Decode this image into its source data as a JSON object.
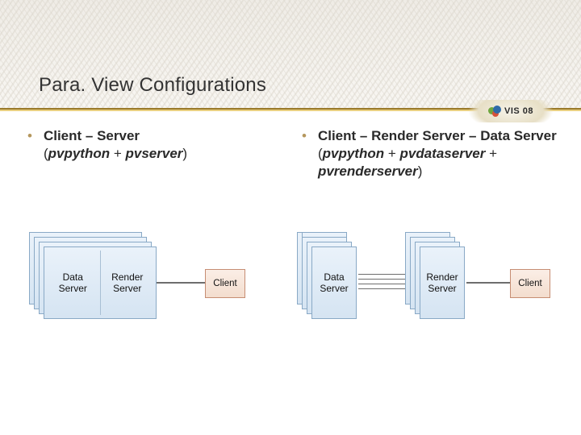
{
  "title": "Para. View Configurations",
  "logo": {
    "text": "VIS 08"
  },
  "left": {
    "heading": "Client – Server",
    "sub_open": "(",
    "sub_a": "pvpython",
    "sub_mid": " + ",
    "sub_b": "pvserver",
    "sub_close": ")",
    "card_data_server": "Data\nServer",
    "card_render_server": "Render\nServer",
    "client": "Client"
  },
  "right": {
    "heading": "Client – Render Server – Data Server",
    "sub_open": "(",
    "sub_a": "pvpython",
    "sub_mid1": " + ",
    "sub_b": "pvdataserver",
    "sub_mid2": " + ",
    "sub_c": "pvrenderserver",
    "sub_close": ")",
    "card_data_server": "Data\nServer",
    "card_render_server": "Render\nServer",
    "client": "Client"
  }
}
